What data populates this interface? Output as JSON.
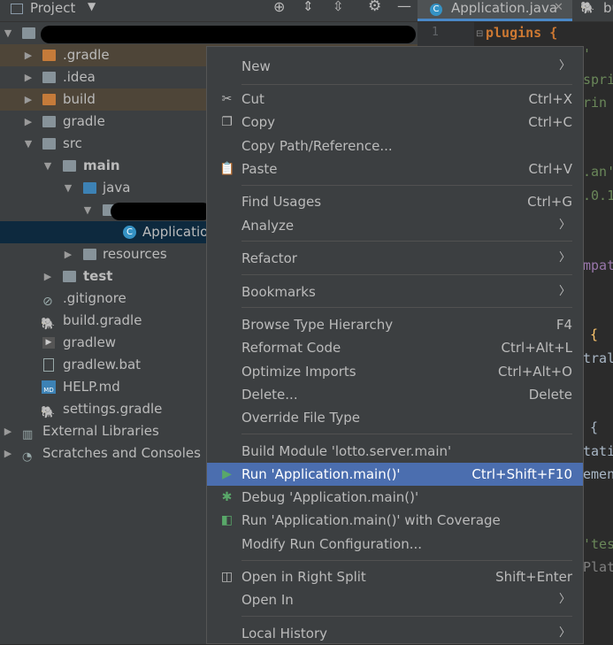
{
  "project_header": {
    "title": "Project"
  },
  "editor_tabs": [
    {
      "label": "Application.java",
      "close": "✕"
    },
    {
      "label": "bu"
    }
  ],
  "tree": [
    {
      "label": "",
      "bold": false
    },
    {
      "label": ".gradle"
    },
    {
      "label": ".idea"
    },
    {
      "label": "build"
    },
    {
      "label": "gradle"
    },
    {
      "label": "src"
    },
    {
      "label": "main"
    },
    {
      "label": "java"
    },
    {
      "label": ""
    },
    {
      "label": "Applicatio"
    },
    {
      "label": "resources"
    },
    {
      "label": "test"
    },
    {
      "label": ".gitignore"
    },
    {
      "label": "build.gradle"
    },
    {
      "label": "gradlew"
    },
    {
      "label": "gradlew.bat"
    },
    {
      "label": "HELP.md"
    },
    {
      "label": "settings.gradle"
    },
    {
      "label": "External Libraries"
    },
    {
      "label": "Scratches and Consoles"
    }
  ],
  "editor": {
    "line_no": "1",
    "line1": "plugins {",
    "fragments": [
      "'",
      "spri",
      "rin",
      ".an'",
      ".0.1",
      "mpat",
      "{",
      "tral",
      "{",
      "tati",
      "emen",
      "'tes",
      "Plat"
    ]
  },
  "menu": {
    "new": "New",
    "cut": "Cut",
    "cut_key": "Ctrl+X",
    "copy": "Copy",
    "copy_key": "Ctrl+C",
    "copy_path": "Copy Path/Reference...",
    "paste": "Paste",
    "paste_key": "Ctrl+V",
    "find_usages": "Find Usages",
    "find_usages_key": "Ctrl+G",
    "analyze": "Analyze",
    "refactor": "Refactor",
    "bookmarks": "Bookmarks",
    "browse_hierarchy": "Browse Type Hierarchy",
    "browse_hierarchy_key": "F4",
    "reformat": "Reformat Code",
    "reformat_key": "Ctrl+Alt+L",
    "optimize": "Optimize Imports",
    "optimize_key": "Ctrl+Alt+O",
    "delete": "Delete...",
    "delete_key": "Delete",
    "override": "Override File Type",
    "build_module": "Build Module 'lotto.server.main'",
    "run": "Run 'Application.main()'",
    "run_key": "Ctrl+Shift+F10",
    "debug": "Debug 'Application.main()'",
    "coverage": "Run 'Application.main()' with Coverage",
    "modify_run": "Modify Run Configuration...",
    "open_right": "Open in Right Split",
    "open_right_key": "Shift+Enter",
    "open_in": "Open In",
    "local_history": "Local History"
  },
  "colors": {
    "accent": "#4b6eaf",
    "panel": "#3c3f41",
    "editor": "#2b2b2b"
  }
}
